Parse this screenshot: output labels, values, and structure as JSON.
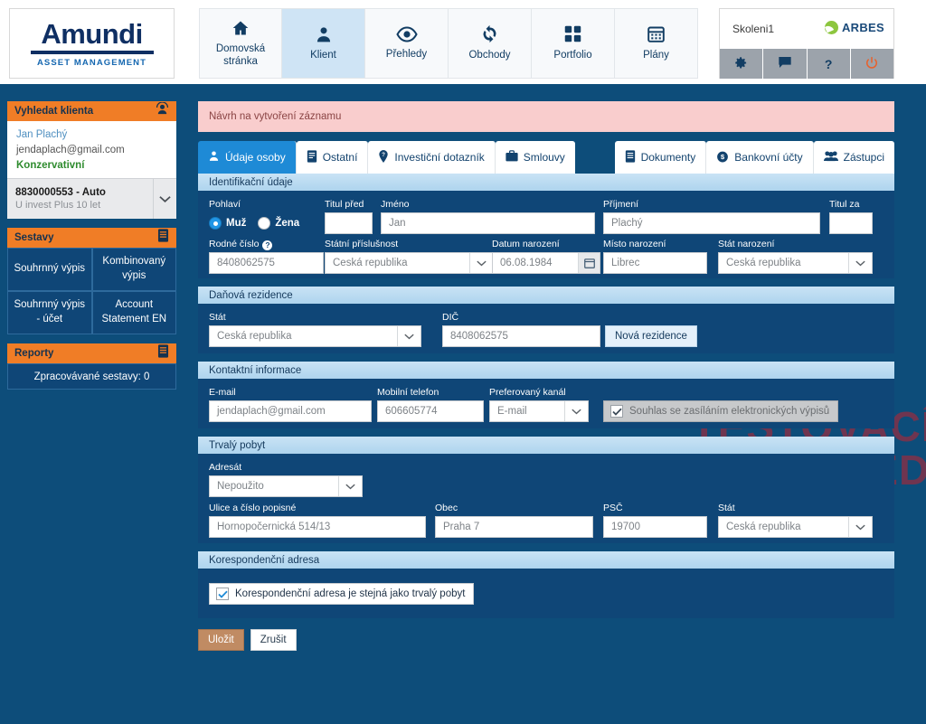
{
  "brand": {
    "logo_word": "Amundi",
    "logo_subtitle": "ASSET MANAGEMENT",
    "accent_orange": "#f07d26",
    "accent_blue": "#0d4d7a",
    "tab_active_blue": "#1e8ad6"
  },
  "nav": {
    "items": [
      {
        "label": "Domovská stránka",
        "icon": "home-icon",
        "active": false
      },
      {
        "label": "Klient",
        "icon": "user-icon",
        "active": true
      },
      {
        "label": "Přehledy",
        "icon": "eye-icon",
        "active": false
      },
      {
        "label": "Obchody",
        "icon": "refresh-icon",
        "active": false
      },
      {
        "label": "Portfolio",
        "icon": "grid-icon",
        "active": false
      },
      {
        "label": "Plány",
        "icon": "calendar-icon",
        "active": false
      }
    ]
  },
  "user": {
    "name": "Skoleni1",
    "vendor": "ARBES",
    "buttons": [
      {
        "name": "settings",
        "icon": "gear-icon"
      },
      {
        "name": "messages",
        "icon": "chat-icon"
      },
      {
        "name": "help",
        "icon": "question-icon"
      },
      {
        "name": "logout",
        "icon": "power-icon"
      }
    ]
  },
  "sidebar": {
    "search_panel": {
      "title": "Vyhledat klienta",
      "icon": "client-search-icon",
      "client_name": "Jan Plachý",
      "client_email": "jendaplach@gmail.com",
      "client_profile": "Konzervativní",
      "account_number": "8830000553 - Auto",
      "account_product": "U invest Plus 10 let"
    },
    "sestavy_panel": {
      "title": "Sestavy",
      "icon": "report-icon",
      "items": [
        "Souhrnný výpis",
        "Kombinovaný výpis",
        "Souhrnný výpis - účet",
        "Account Statement EN"
      ]
    },
    "reporty_panel": {
      "title": "Reporty",
      "icon": "report-icon",
      "status": "Zpracovávané sestavy: 0"
    }
  },
  "main": {
    "alert": "Návrh na vytvoření záznamu",
    "watermark_line1": "TESTOVACÍ",
    "watermark_line2": "PROSTŘEDÍ",
    "tabs_left": [
      {
        "label": "Údaje osoby",
        "icon": "person-icon",
        "active": true
      },
      {
        "label": "Ostatní",
        "icon": "book-icon",
        "active": false
      },
      {
        "label": "Investiční dotazník",
        "icon": "question-pin-icon",
        "active": false
      },
      {
        "label": "Smlouvy",
        "icon": "briefcase-icon",
        "active": false
      }
    ],
    "tabs_right": [
      {
        "label": "Dokumenty",
        "icon": "document-icon"
      },
      {
        "label": "Bankovní účty",
        "icon": "money-icon"
      },
      {
        "label": "Zástupci",
        "icon": "group-icon"
      }
    ],
    "sections": {
      "identification": {
        "title": "Identifikační údaje",
        "gender_label": "Pohlaví",
        "gender_options": [
          {
            "label": "Muž",
            "selected": true
          },
          {
            "label": "Žena",
            "selected": false
          }
        ],
        "title_before_label": "Titul před",
        "title_before_value": "",
        "first_name_label": "Jméno",
        "first_name_value": "Jan",
        "last_name_label": "Příjmení",
        "last_name_value": "Plachý",
        "title_after_label": "Titul za",
        "title_after_value": "",
        "birth_number_label": "Rodné číslo",
        "birth_number_help": "?",
        "birth_number_value": "8408062575",
        "citizenship_label": "Státní příslušnost",
        "citizenship_value": "Česká republika",
        "birth_date_label": "Datum narození",
        "birth_date_value": "06.08.1984",
        "birth_place_label": "Místo narození",
        "birth_place_value": "Librec",
        "birth_country_label": "Stát narození",
        "birth_country_value": "Česká republika"
      },
      "tax_residence": {
        "title": "Daňová rezidence",
        "state_label": "Stát",
        "state_value": "Česká republika",
        "tin_label": "DIČ",
        "tin_value": "8408062575",
        "new_residence_button": "Nová rezidence"
      },
      "contact": {
        "title": "Kontaktní informace",
        "email_label": "E-mail",
        "email_value": "jendaplach@gmail.com",
        "mobile_label": "Mobilní telefon",
        "mobile_value": "606605774",
        "channel_label": "Preferovaný kanál",
        "channel_value": "E-mail",
        "consent_label": "Souhlas se zasíláním elektronických výpisů",
        "consent_checked": true
      },
      "permanent_address": {
        "title": "Trvalý pobyt",
        "addressee_label": "Adresát",
        "addressee_value": "Nepoužito",
        "street_label": "Ulice a číslo popisné",
        "street_value": "Hornopočernická 514/13",
        "city_label": "Obec",
        "city_value": "Praha 7",
        "zip_label": "PSČ",
        "zip_value": "19700",
        "state_label": "Stát",
        "state_value": "Česká republika"
      },
      "correspondence_address": {
        "title": "Korespondenční adresa",
        "same_as_label": "Korespondenční adresa je stejná jako trvalý pobyt",
        "same_as_checked": true
      }
    },
    "actions": {
      "save": "Uložit",
      "cancel": "Zrušit"
    }
  }
}
